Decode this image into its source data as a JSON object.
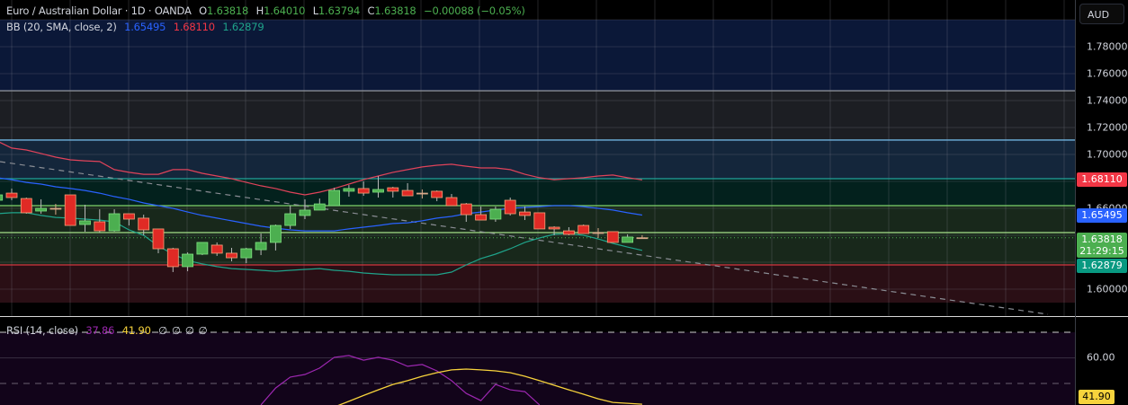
{
  "legend": {
    "symbol": "Euro / Australian Dollar · 1D · OANDA",
    "open_label": "O",
    "open": "1.63818",
    "high_label": "H",
    "high": "1.64010",
    "low_label": "L",
    "low": "1.63794",
    "close_label": "C",
    "close": "1.63818",
    "change": "−0.00088 (−0.05%)",
    "bb_title": "BB (20, SMA, close, 2)",
    "bb_basis": "1.65495",
    "bb_upper": "1.68110",
    "bb_lower": "1.62879",
    "rsi_title": "RSI (14, close)",
    "rsi_value": "37.86",
    "rsi_ma": "41.90",
    "rsi_extra": [
      "∅",
      "∅",
      "∅",
      "∅"
    ]
  },
  "axis": {
    "currency": "AUD",
    "ticks": [
      "1.78000",
      "1.76000",
      "1.74000",
      "1.72000",
      "1.70000",
      "1.66000",
      "1.60000"
    ],
    "tick_values": [
      1.78,
      1.76,
      1.74,
      1.72,
      1.7,
      1.66,
      1.6
    ],
    "badges": {
      "upper": "1.68110",
      "basis": "1.65495",
      "price": "1.63818",
      "countdown": "21:29:15",
      "lower": "1.62879"
    },
    "rsi_tick": "60.00",
    "rsi_ma_badge": "41.90"
  },
  "colors": {
    "up": "#4caf50",
    "down": "#e02a25",
    "doji": "#d9a88a",
    "bb_upper": "#e0435a",
    "bb_basis": "#2962ff",
    "bb_lower": "#1fa38a",
    "rsi": "#9c27b0",
    "rsi_ma": "#f7d33c",
    "price_badge": "#4caf50",
    "upper_badge": "#f23645",
    "basis_badge": "#2962ff",
    "lower_badge": "#089981"
  },
  "chart_data": {
    "type": "candlestick",
    "title": "Euro / Australian Dollar · 1D · OANDA",
    "ylim": [
      1.59,
      1.8
    ],
    "first_bar_index": -1,
    "candles": [
      [
        1.666,
        1.672,
        1.6647,
        1.67
      ],
      [
        1.6713,
        1.6747,
        1.666,
        1.668
      ],
      [
        1.6673,
        1.668,
        1.656,
        1.6567
      ],
      [
        1.658,
        1.6667,
        1.656,
        1.66
      ],
      [
        1.66,
        1.6633,
        1.6553,
        1.66
      ],
      [
        1.67,
        1.67,
        1.6473,
        1.6473
      ],
      [
        1.648,
        1.6627,
        1.6427,
        1.6507
      ],
      [
        1.65,
        1.6593,
        1.642,
        1.6433
      ],
      [
        1.6433,
        1.6593,
        1.6427,
        1.656
      ],
      [
        1.656,
        1.656,
        1.6473,
        1.652
      ],
      [
        1.6527,
        1.6553,
        1.64,
        1.644
      ],
      [
        1.6447,
        1.6447,
        1.6267,
        1.63
      ],
      [
        1.63,
        1.6307,
        1.6127,
        1.6167
      ],
      [
        1.6167,
        1.6273,
        1.6133,
        1.626
      ],
      [
        1.626,
        1.6347,
        1.6253,
        1.6347
      ],
      [
        1.6327,
        1.6347,
        1.6247,
        1.6267
      ],
      [
        1.6267,
        1.6307,
        1.6207,
        1.6233
      ],
      [
        1.6233,
        1.6307,
        1.6193,
        1.63
      ],
      [
        1.6293,
        1.6413,
        1.6253,
        1.6347
      ],
      [
        1.6347,
        1.648,
        1.6287,
        1.6473
      ],
      [
        1.6473,
        1.662,
        1.6447,
        1.656
      ],
      [
        1.6547,
        1.6667,
        1.652,
        1.6587
      ],
      [
        1.6587,
        1.6673,
        1.6587,
        1.6633
      ],
      [
        1.662,
        1.6753,
        1.662,
        1.6733
      ],
      [
        1.6727,
        1.6773,
        1.6687,
        1.6747
      ],
      [
        1.6747,
        1.68,
        1.6693,
        1.6713
      ],
      [
        1.672,
        1.684,
        1.668,
        1.674
      ],
      [
        1.6753,
        1.676,
        1.668,
        1.6727
      ],
      [
        1.6733,
        1.6787,
        1.6693,
        1.6693
      ],
      [
        1.6713,
        1.674,
        1.6673,
        1.6713
      ],
      [
        1.6727,
        1.6733,
        1.6653,
        1.668
      ],
      [
        1.668,
        1.6707,
        1.662,
        1.662
      ],
      [
        1.6633,
        1.664,
        1.65,
        1.6553
      ],
      [
        1.6553,
        1.6613,
        1.6513,
        1.6513
      ],
      [
        1.652,
        1.6613,
        1.65,
        1.6593
      ],
      [
        1.666,
        1.668,
        1.6547,
        1.656
      ],
      [
        1.6573,
        1.6613,
        1.6513,
        1.6547
      ],
      [
        1.6567,
        1.6567,
        1.6447,
        1.6447
      ],
      [
        1.646,
        1.6467,
        1.64,
        1.6447
      ],
      [
        1.6433,
        1.646,
        1.64,
        1.6407
      ],
      [
        1.6473,
        1.648,
        1.6413,
        1.6413
      ],
      [
        1.642,
        1.6453,
        1.638,
        1.642
      ],
      [
        1.6427,
        1.6427,
        1.6347,
        1.6347
      ],
      [
        1.6347,
        1.6407,
        1.6347,
        1.6387
      ],
      [
        1.63818,
        1.6401,
        1.63794,
        1.63818
      ]
    ],
    "bb_upper": [
      1.71,
      1.7047,
      1.7033,
      1.7007,
      1.698,
      1.696,
      1.6953,
      1.6947,
      1.6887,
      1.6867,
      1.6853,
      1.6853,
      1.6887,
      1.6887,
      1.686,
      1.684,
      1.682,
      1.6793,
      1.6767,
      1.6747,
      1.672,
      1.67,
      1.672,
      1.6747,
      1.678,
      1.6813,
      1.684,
      1.6867,
      1.6887,
      1.6907,
      1.692,
      1.6927,
      1.6913,
      1.69,
      1.69,
      1.6887,
      1.6853,
      1.6827,
      1.6813,
      1.682,
      1.6827,
      1.684,
      1.6847,
      1.6827,
      1.6811
    ],
    "bb_basis": [
      1.6827,
      1.6813,
      1.6793,
      1.678,
      1.676,
      1.6747,
      1.6733,
      1.6713,
      1.6687,
      1.6667,
      1.664,
      1.662,
      1.66,
      1.6573,
      1.6547,
      1.6527,
      1.6507,
      1.6487,
      1.6467,
      1.6453,
      1.644,
      1.6433,
      1.6433,
      1.6433,
      1.6447,
      1.646,
      1.6473,
      1.6487,
      1.6493,
      1.6507,
      1.6527,
      1.654,
      1.656,
      1.6573,
      1.6587,
      1.66,
      1.6607,
      1.6613,
      1.662,
      1.662,
      1.6613,
      1.66,
      1.6587,
      1.6567,
      1.655
    ],
    "bb_lower": [
      1.656,
      1.6567,
      1.6567,
      1.6547,
      1.6533,
      1.6527,
      1.652,
      1.6513,
      1.65,
      1.644,
      1.64,
      1.632,
      1.626,
      1.6213,
      1.6187,
      1.6167,
      1.6153,
      1.6147,
      1.614,
      1.6133,
      1.614,
      1.6147,
      1.6153,
      1.614,
      1.6133,
      1.612,
      1.6113,
      1.6107,
      1.6107,
      1.6107,
      1.6107,
      1.6127,
      1.618,
      1.6227,
      1.626,
      1.63,
      1.6347,
      1.638,
      1.6407,
      1.6413,
      1.64,
      1.6373,
      1.634,
      1.6313,
      1.6288
    ],
    "levels": [
      1.7473,
      1.7107,
      1.682,
      1.662,
      1.642,
      1.618
    ],
    "level_colors": [
      "#8a8d94",
      "#6fb3e0",
      "#22a39a",
      "#7fd36b",
      "#a6e08a",
      "#d2343f"
    ],
    "zones": [
      {
        "from": 1.8,
        "to": 1.7473,
        "color": "#0b1838"
      },
      {
        "from": 1.7473,
        "to": 1.7107,
        "color": "#1c1e23"
      },
      {
        "from": 1.7107,
        "to": 1.682,
        "color": "#14263b"
      },
      {
        "from": 1.682,
        "to": 1.662,
        "color": "#03211d"
      },
      {
        "from": 1.662,
        "to": 1.618,
        "color": "#18281b"
      },
      {
        "from": 1.618,
        "to": 1.59,
        "color": "#2a0f15"
      }
    ],
    "rsi": {
      "ylim_top": 70,
      "bands": [
        70,
        50
      ],
      "grid": [
        60
      ],
      "points": [
        [
          17,
          41.6
        ],
        [
          18,
          48.2
        ],
        [
          19,
          52.5
        ],
        [
          20,
          53.5
        ],
        [
          21,
          56.0
        ],
        [
          22,
          60.2
        ],
        [
          23,
          60.9
        ],
        [
          24,
          59.1
        ],
        [
          25,
          60.2
        ],
        [
          26,
          59.1
        ],
        [
          27,
          56.7
        ],
        [
          28,
          57.4
        ],
        [
          29,
          54.9
        ],
        [
          30,
          51.1
        ],
        [
          31,
          46.1
        ],
        [
          32,
          43.3
        ],
        [
          33,
          49.6
        ],
        [
          34,
          47.5
        ],
        [
          35,
          46.8
        ],
        [
          36,
          41.6
        ]
      ],
      "ma_points": [
        [
          22,
          40.8
        ],
        [
          23,
          43.0
        ],
        [
          24,
          45.3
        ],
        [
          25,
          47.5
        ],
        [
          26,
          49.6
        ],
        [
          27,
          51.1
        ],
        [
          28,
          52.8
        ],
        [
          29,
          54.2
        ],
        [
          30,
          55.3
        ],
        [
          31,
          55.6
        ],
        [
          32,
          55.3
        ],
        [
          33,
          54.9
        ],
        [
          34,
          54.2
        ],
        [
          35,
          52.8
        ],
        [
          36,
          51.1
        ],
        [
          37,
          49.3
        ],
        [
          38,
          47.5
        ],
        [
          39,
          45.8
        ],
        [
          40,
          44.0
        ],
        [
          41,
          42.6
        ],
        [
          43,
          41.9
        ]
      ]
    }
  }
}
